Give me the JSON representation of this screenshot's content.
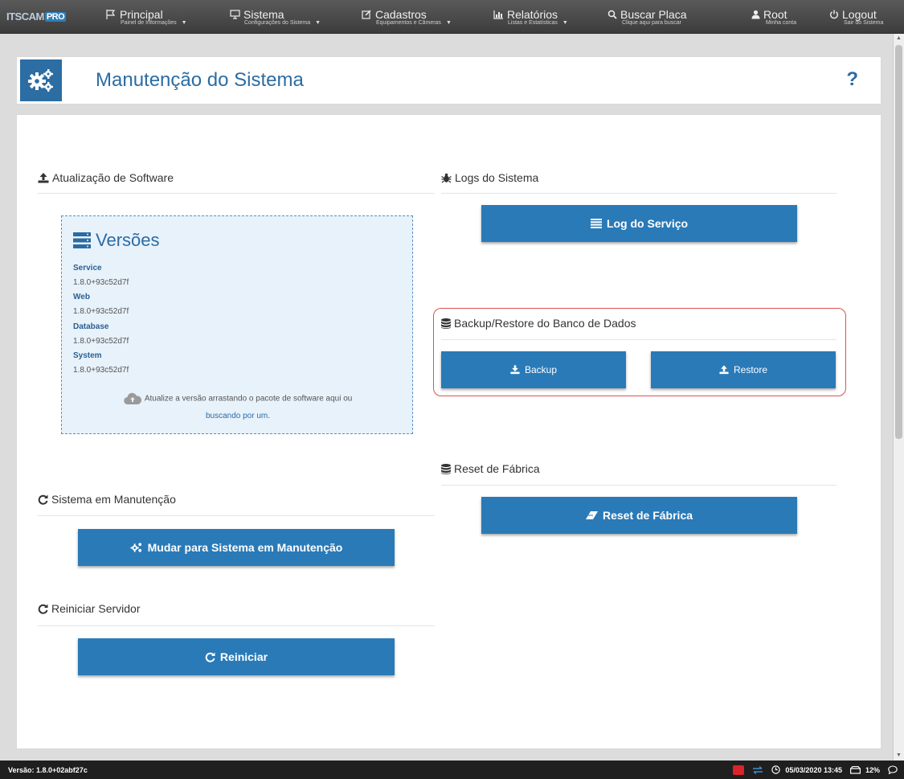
{
  "nav": {
    "logo_text": "ITSCAM",
    "logo_pro": "PRO",
    "items": [
      {
        "label": "Principal",
        "sub": "Painel de Informações",
        "icon": "flag-icon",
        "caret": "▼"
      },
      {
        "label": "Sistema",
        "sub": "Configurações do Sistema",
        "icon": "monitor-icon",
        "caret": "▼"
      },
      {
        "label": "Cadastros",
        "sub": "Equipamentos e Câmeras",
        "icon": "edit-icon",
        "caret": "▼"
      },
      {
        "label": "Relatórios",
        "sub": "Listas e Estatísticas",
        "icon": "bar-chart-icon",
        "caret": "▼"
      },
      {
        "label": "Buscar Placa",
        "sub": "Clique aqui para buscar",
        "icon": "search-icon"
      },
      {
        "label": "Root",
        "sub": "Minha conta",
        "icon": "user-icon"
      },
      {
        "label": "Logout",
        "sub": "Sair do Sistema",
        "icon": "power-icon"
      }
    ]
  },
  "header": {
    "title": "Manutenção do Sistema",
    "help": "?"
  },
  "software": {
    "title": "Atualização de Software",
    "versions_title": "Versões",
    "entries": [
      {
        "label": "Service",
        "value": "1.8.0+93c52d7f"
      },
      {
        "label": "Web",
        "value": "1.8.0+93c52d7f"
      },
      {
        "label": "Database",
        "value": "1.8.0+93c52d7f"
      },
      {
        "label": "System",
        "value": "1.8.0+93c52d7f"
      }
    ],
    "drop_text": "Atualize a versão arrastando o pacote de software aqui ou",
    "drop_link": "buscando por um."
  },
  "logs": {
    "title": "Logs do Sistema",
    "button": "Log do Serviço"
  },
  "backup": {
    "title": "Backup/Restore do Banco de Dados",
    "backup_button": "Backup",
    "restore_button": "Restore"
  },
  "reset": {
    "title": "Reset de Fábrica",
    "button": "Reset de Fábrica"
  },
  "maintenance": {
    "title": "Sistema em Manutenção",
    "button": "Mudar para Sistema em Manutenção"
  },
  "restart": {
    "title": "Reiniciar Servidor",
    "button": "Reiniciar"
  },
  "footer": {
    "version": "Versão: 1.8.0+02abf27c",
    "datetime": "05/03/2020 13:45",
    "disk": "12%"
  },
  "colors": {
    "primary": "#2a7ab8",
    "title": "#2b6ca3",
    "highlight": "#d9534f"
  }
}
